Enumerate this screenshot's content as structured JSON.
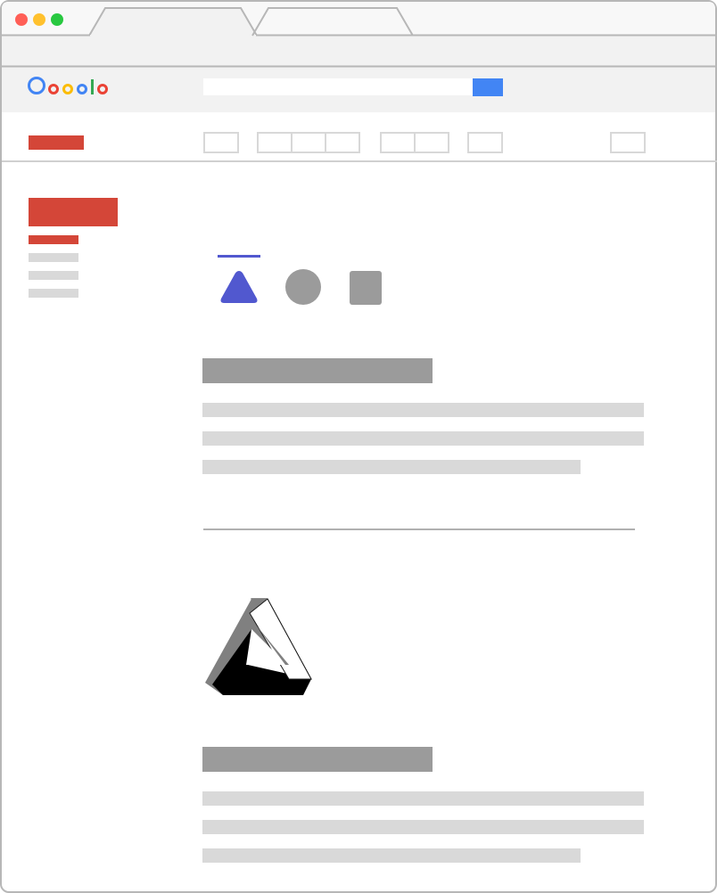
{
  "browser": {
    "traffic_lights": {
      "close": "#ff5f57",
      "minimize": "#ffc12e",
      "maximize": "#28c840"
    },
    "tabs": [
      {
        "label": "",
        "state": "active"
      },
      {
        "label": "",
        "state": "inactive"
      }
    ],
    "chrome_color": "#f2f2f2",
    "border_color": "#b7b7b7"
  },
  "header": {
    "logo": {
      "text": "Ooooolo",
      "colors": [
        "#4285f4",
        "#ea4335",
        "#fbbc05",
        "#4285f4",
        "#34a853",
        "#ea4335"
      ]
    },
    "search": {
      "value": "",
      "placeholder": ""
    },
    "search_button_color": "#4285f4"
  },
  "toolbar": {
    "brand_block_color": "#d44638",
    "button_groups": [
      1,
      3,
      2,
      1,
      1
    ]
  },
  "sidebar": {
    "primary_color": "#d44638",
    "items": [
      "active",
      "inactive",
      "inactive",
      "inactive"
    ]
  },
  "main": {
    "tabs": [
      {
        "icon": "triangle-icon",
        "selected": true,
        "color": "#5158cf"
      },
      {
        "icon": "circle-icon",
        "selected": false,
        "color": "#9b9b9b"
      },
      {
        "icon": "square-icon",
        "selected": false,
        "color": "#9b9b9b"
      }
    ],
    "sections": [
      {
        "heading_lines": 1,
        "body_lines": 3
      },
      {
        "image": "impossible-triangle-icon",
        "heading_lines": 1,
        "body_lines": 3
      }
    ],
    "skeleton_colors": {
      "heading": "#9b9b9b",
      "text": "#d9d9d9"
    }
  }
}
